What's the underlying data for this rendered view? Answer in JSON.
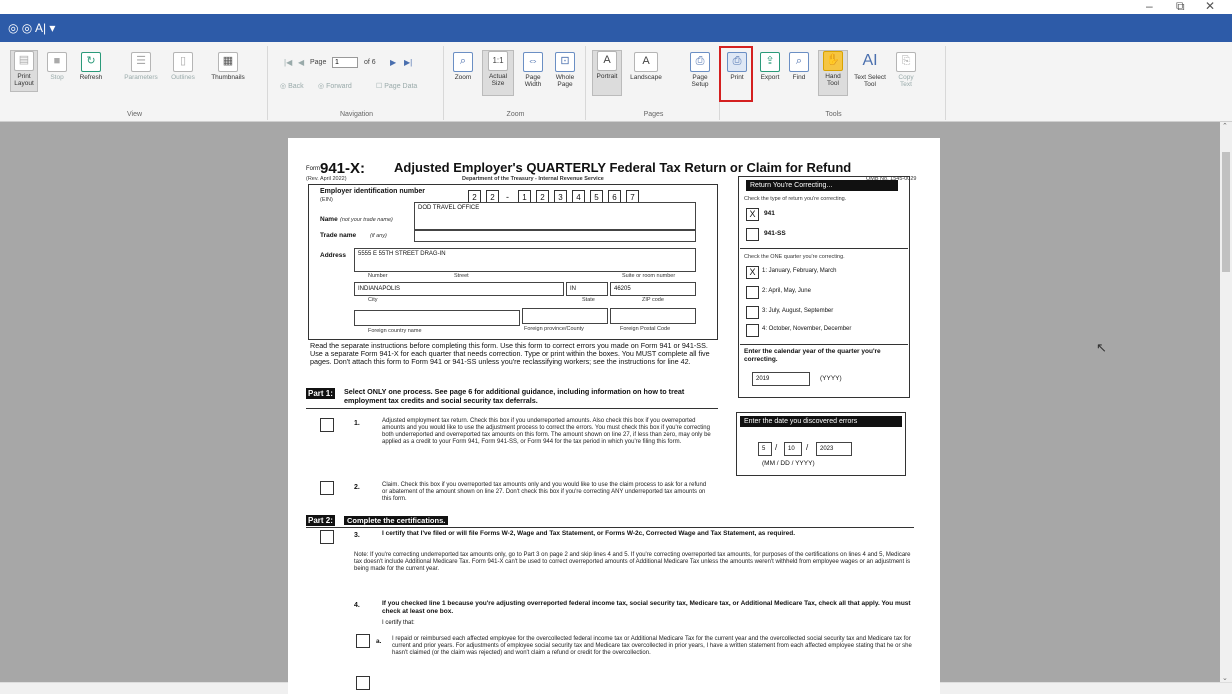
{
  "window": {
    "minimize_glyph": "–",
    "restore_glyph": "⧉",
    "close_glyph": "✕"
  },
  "titlebar": {
    "text": "◎ ◎ A| ▾"
  },
  "ribbon": {
    "groups": {
      "view": "View",
      "navigation": "Navigation",
      "zoom": "Zoom",
      "pages": "Pages",
      "tools": "Tools"
    },
    "print_layout": "Print Layout",
    "stop": "Stop",
    "refresh": "Refresh",
    "parameters": "Parameters",
    "outlines": "Outlines",
    "thumbnails": "Thumbnails",
    "page_label": "Page",
    "page_value": "1",
    "page_of": "of 6",
    "back": "Back",
    "forward": "Forward",
    "page_data": "Page Data",
    "zoom": "Zoom",
    "actual_size": "Actual Size",
    "page_width": "Page Width",
    "whole_page": "Whole Page",
    "portrait": "Portrait",
    "landscape": "Landscape",
    "page_setup": "Page Setup",
    "print": "Print",
    "export": "Export",
    "find": "Find",
    "hand_tool": "Hand Tool",
    "text_select_tool": "Text Select Tool",
    "copy_text": "Copy Text"
  },
  "form": {
    "form_word": "Form",
    "form_number": "941-X:",
    "title": "Adjusted Employer's QUARTERLY Federal Tax Return or Claim for Refund",
    "rev": "(Rev. April 2022)",
    "dept": "Department of the Treasury - Internal Revenue Service",
    "omb": "OMB No. 1545-0029",
    "ein_label": "Employer identification number",
    "ein_sub": "(EIN)",
    "ein_digits": [
      "2",
      "2",
      "-",
      "1",
      "2",
      "3",
      "4",
      "5",
      "6",
      "7"
    ],
    "name_label": "Name",
    "name_sub": "(not your trade name)",
    "name_value": "DOD TRAVEL OFFICE",
    "trade_label": "Trade name",
    "trade_sub": "(if any)",
    "address_label": "Address",
    "address_value": "5555 E 55TH STREET DRAG-IN",
    "number_lbl": "Number",
    "street_lbl": "Street",
    "suite_lbl": "Suite or room number",
    "city_value": "INDIANAPOLIS",
    "state_value": "IN",
    "zip_value": "46205",
    "city_lbl": "City",
    "state_lbl": "State",
    "zip_lbl": "ZIP code",
    "foreign_country": "Foreign country name",
    "foreign_province": "Foreign province/County",
    "foreign_postal": "Foreign Postal Code",
    "read_text": "Read the separate instructions before completing this form. Use this form to correct errors you made on Form 941 or 941-SS. Use a separate Form 941-X for each quarter that needs correction. Type or print within the boxes. You MUST complete all five pages. Don't attach this form to Form 941 or 941-SS unless you're reclassifying workers; see the instructions for line 42.",
    "return_header": "Return You're Correcting...",
    "return_sub": "Check the type of return you're correcting.",
    "r941": "941",
    "r941_check": "X",
    "r941ss": "941-SS",
    "quarter_sub": "Check the ONE quarter you're correcting.",
    "q1": "1: January, February, March",
    "q1_check": "X",
    "q2": "2: April, May, June",
    "q3": "3: July, August, September",
    "q4": "4: October, November, December",
    "year_label": "Enter the calendar year of the quarter you're correcting.",
    "year_value": "2019",
    "year_fmt": "(YYYY)",
    "date_header": "Enter the date you discovered errors",
    "date_m": "5",
    "date_d": "10",
    "date_y": "2023",
    "date_fmt": "(MM / DD / YYYY)",
    "part1_tag": "Part 1:",
    "part1_text": "Select ONLY one process. See page 6 for additional guidance, including information on how to treat employment tax credits and social security tax deferrals.",
    "l1_num": "1.",
    "l1_text": "Adjusted employment tax return. Check this box if you underreported amounts. Also check this box if you overreported amounts and you would like to use the adjustment process to correct the errors. You must check this box if you're correcting both underreported and overreported tax amounts on this form. The amount shown on line 27, if less than zero, may only be applied as a credit to your Form 941, Form 941-SS, or Form 944 for the tax period in which you're filing this form.",
    "l2_num": "2.",
    "l2_text": "Claim. Check this box if you overreported tax amounts only and you would like to use the claim process to ask for a refund or abatement of the amount shown on line 27. Don't check this box if you're correcting ANY underreported tax amounts on this form.",
    "part2_tag": "Part 2:",
    "part2_text": "Complete the certifications.",
    "l3_num": "3.",
    "l3_text": "I certify that I've filed or will file Forms W-2, Wage and Tax Statement, or Forms W-2c, Corrected Wage and Tax Statement, as required.",
    "note_text": "Note: If you're correcting underreported tax amounts only, go to Part 3 on page 2 and skip lines 4 and 5. If you're correcting overreported tax amounts, for purposes of the certifications on lines 4 and 5, Medicare tax doesn't include Additional Medicare Tax. Form 941-X can't be used to correct overreported amounts of Additional Medicare Tax unless the amounts weren't withheld from employee wages or an adjustment is being made for the current year.",
    "l4_num": "4.",
    "l4_text": "If you checked line 1 because you're adjusting overreported federal income tax, social security tax, Medicare tax, or Additional Medicare Tax, check all that apply. You must check at least one box.",
    "l4_certify": "I certify that:",
    "l4a": "a.",
    "l4a_text": "I repaid or reimbursed each affected employee for the overcollected federal income tax or Additional Medicare Tax for the current year and the overcollected social security tax and Medicare tax for current and prior years. For adjustments of employee social security tax and Medicare tax overcollected in prior years, I have a written statement from each affected employee stating that he or she hasn't claimed (or the claim was rejected) and won't claim a refund or credit for the overcollection."
  }
}
